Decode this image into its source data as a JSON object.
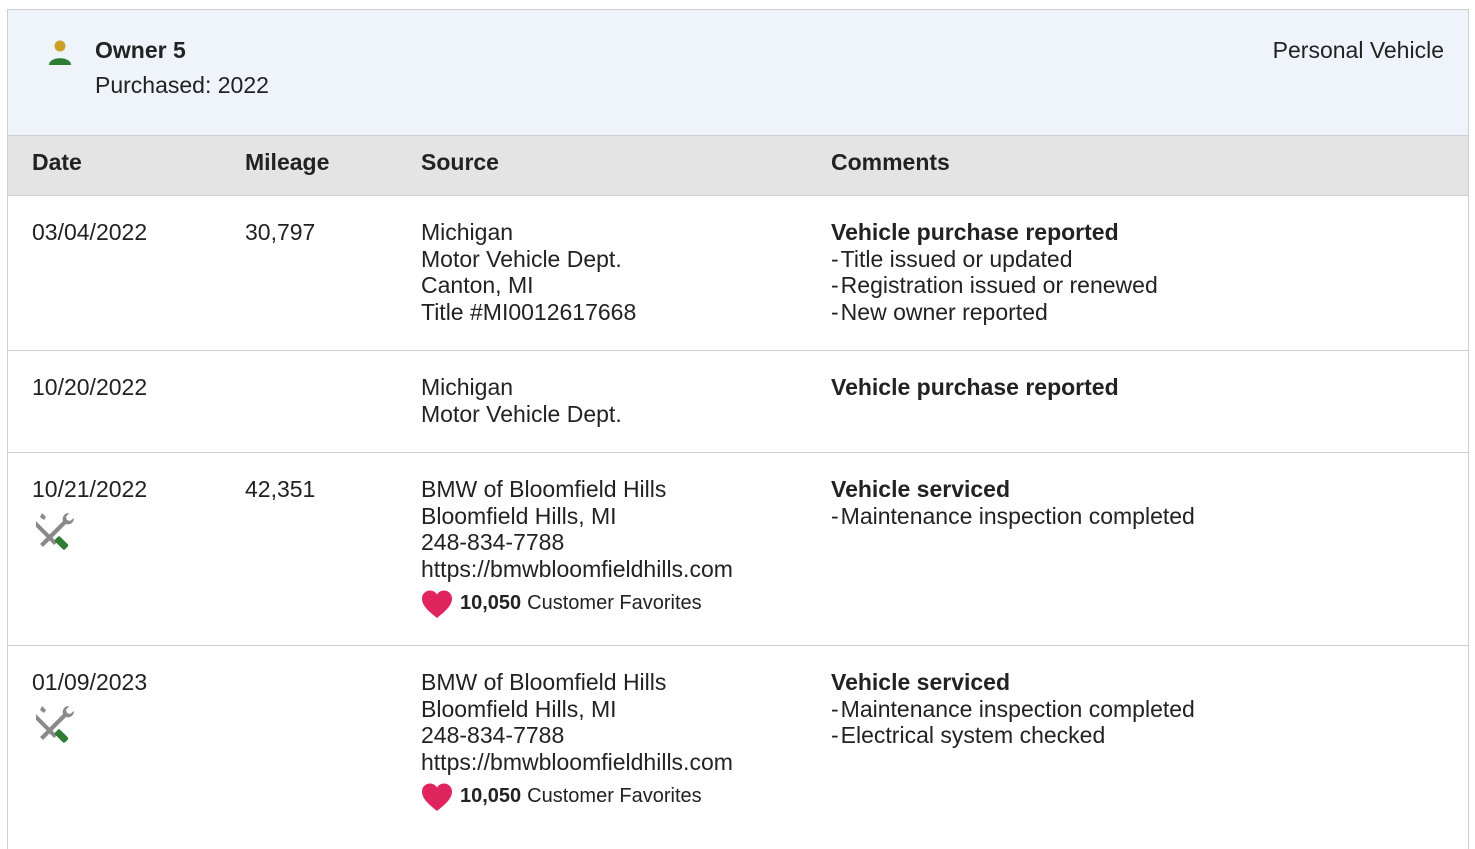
{
  "owner": {
    "name": "Owner 5",
    "purchased": "Purchased: 2022",
    "type": "Personal Vehicle",
    "icon": "person-icon"
  },
  "columns": {
    "date": "Date",
    "mileage": "Mileage",
    "source": "Source",
    "comments": "Comments"
  },
  "records": [
    {
      "date": "03/04/2022",
      "mileage": "30,797",
      "source": [
        "Michigan",
        "Motor Vehicle Dept.",
        "Canton, MI",
        "Title #MI0012617668"
      ],
      "comment_title": "Vehicle purchase reported",
      "comment_items": [
        "Title issued or updated",
        "Registration issued or renewed",
        "New owner reported"
      ]
    },
    {
      "date": "10/20/2022",
      "mileage": "",
      "source": [
        "Michigan",
        "Motor Vehicle Dept."
      ],
      "comment_title": "Vehicle purchase reported",
      "comment_items": []
    },
    {
      "date": "10/21/2022",
      "mileage": "42,351",
      "service_icon": "wrench-screwdriver-icon",
      "source": [
        "BMW of Bloomfield Hills",
        "Bloomfield Hills, MI",
        "248-834-7788",
        "https://bmwbloomfieldhills.com"
      ],
      "favorites_count": "10,050",
      "favorites_label": "Customer Favorites",
      "comment_title": "Vehicle serviced",
      "comment_items": [
        "Maintenance inspection completed"
      ]
    },
    {
      "date": "01/09/2023",
      "mileage": "",
      "service_icon": "wrench-screwdriver-icon",
      "source": [
        "BMW of Bloomfield Hills",
        "Bloomfield Hills, MI",
        "248-834-7788",
        "https://bmwbloomfieldhills.com"
      ],
      "favorites_count": "10,050",
      "favorites_label": "Customer Favorites",
      "comment_title": "Vehicle serviced",
      "comment_items": [
        "Maintenance inspection completed",
        "Electrical system checked"
      ]
    }
  ],
  "colors": {
    "header_bg": "#eef4fa",
    "table_head_bg": "#e4e4e4",
    "heart": "#e0245e",
    "service_green": "#2e7d32",
    "owner_head": "#c9a227",
    "owner_body": "#2e7d32"
  }
}
